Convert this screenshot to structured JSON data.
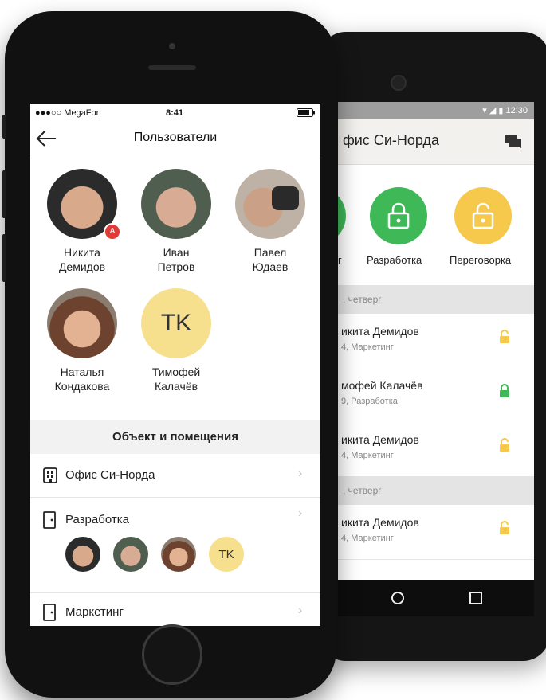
{
  "android": {
    "status_time": "12:30",
    "title": "фис Си-Норда",
    "rooms": [
      {
        "label": "г",
        "color": "#3fb858",
        "kind": "partial"
      },
      {
        "label": "Разработка",
        "color": "#3fb858"
      },
      {
        "label": "Переговорка",
        "color": "#f6c84b"
      }
    ],
    "sections": [
      ", четверг",
      ", четверг"
    ],
    "rows": [
      {
        "name": "икита Демидов",
        "sub": "4, Маркетинг",
        "lock_color": "#f6c84b"
      },
      {
        "name": "мофей Калачёв",
        "sub": "9, Разработка",
        "lock_color": "#3fb858"
      },
      {
        "name": "икита Демидов",
        "sub": "4, Маркетинг",
        "lock_color": "#f6c84b"
      },
      {
        "name": "икита Демидов",
        "sub": "4, Маркетинг",
        "lock_color": "#f6c84b"
      }
    ],
    "nav": {
      "home_icon": "circle-icon",
      "recents_icon": "square-icon"
    }
  },
  "ios": {
    "status": {
      "carrier": "●●●○○ MegaFon",
      "time": "8:41"
    },
    "title": "Пользователи",
    "users": [
      {
        "first": "Никита",
        "last": "Демидов",
        "badge": "A",
        "tone": "#8a5a44"
      },
      {
        "first": "Иван",
        "last": "Петров",
        "tone": "#6a7a6a"
      },
      {
        "first": "Павел",
        "last": "Юдаев",
        "tone": "#9a8878"
      },
      {
        "first": "Наталья",
        "last": "Кондакова",
        "tone": "#a06a4a"
      },
      {
        "first": "Тимофей",
        "last": "Калачёв",
        "initials": "TK"
      }
    ],
    "section_title": "Объект и помещения",
    "rows": [
      {
        "label": "Офис Си-Норда",
        "icon": "building-icon"
      },
      {
        "label": "Разработка",
        "icon": "door-icon"
      },
      {
        "label": "Маркетинг",
        "icon": "door-icon"
      }
    ],
    "room_members_initials": "TK",
    "accent": "#f7e08d"
  }
}
